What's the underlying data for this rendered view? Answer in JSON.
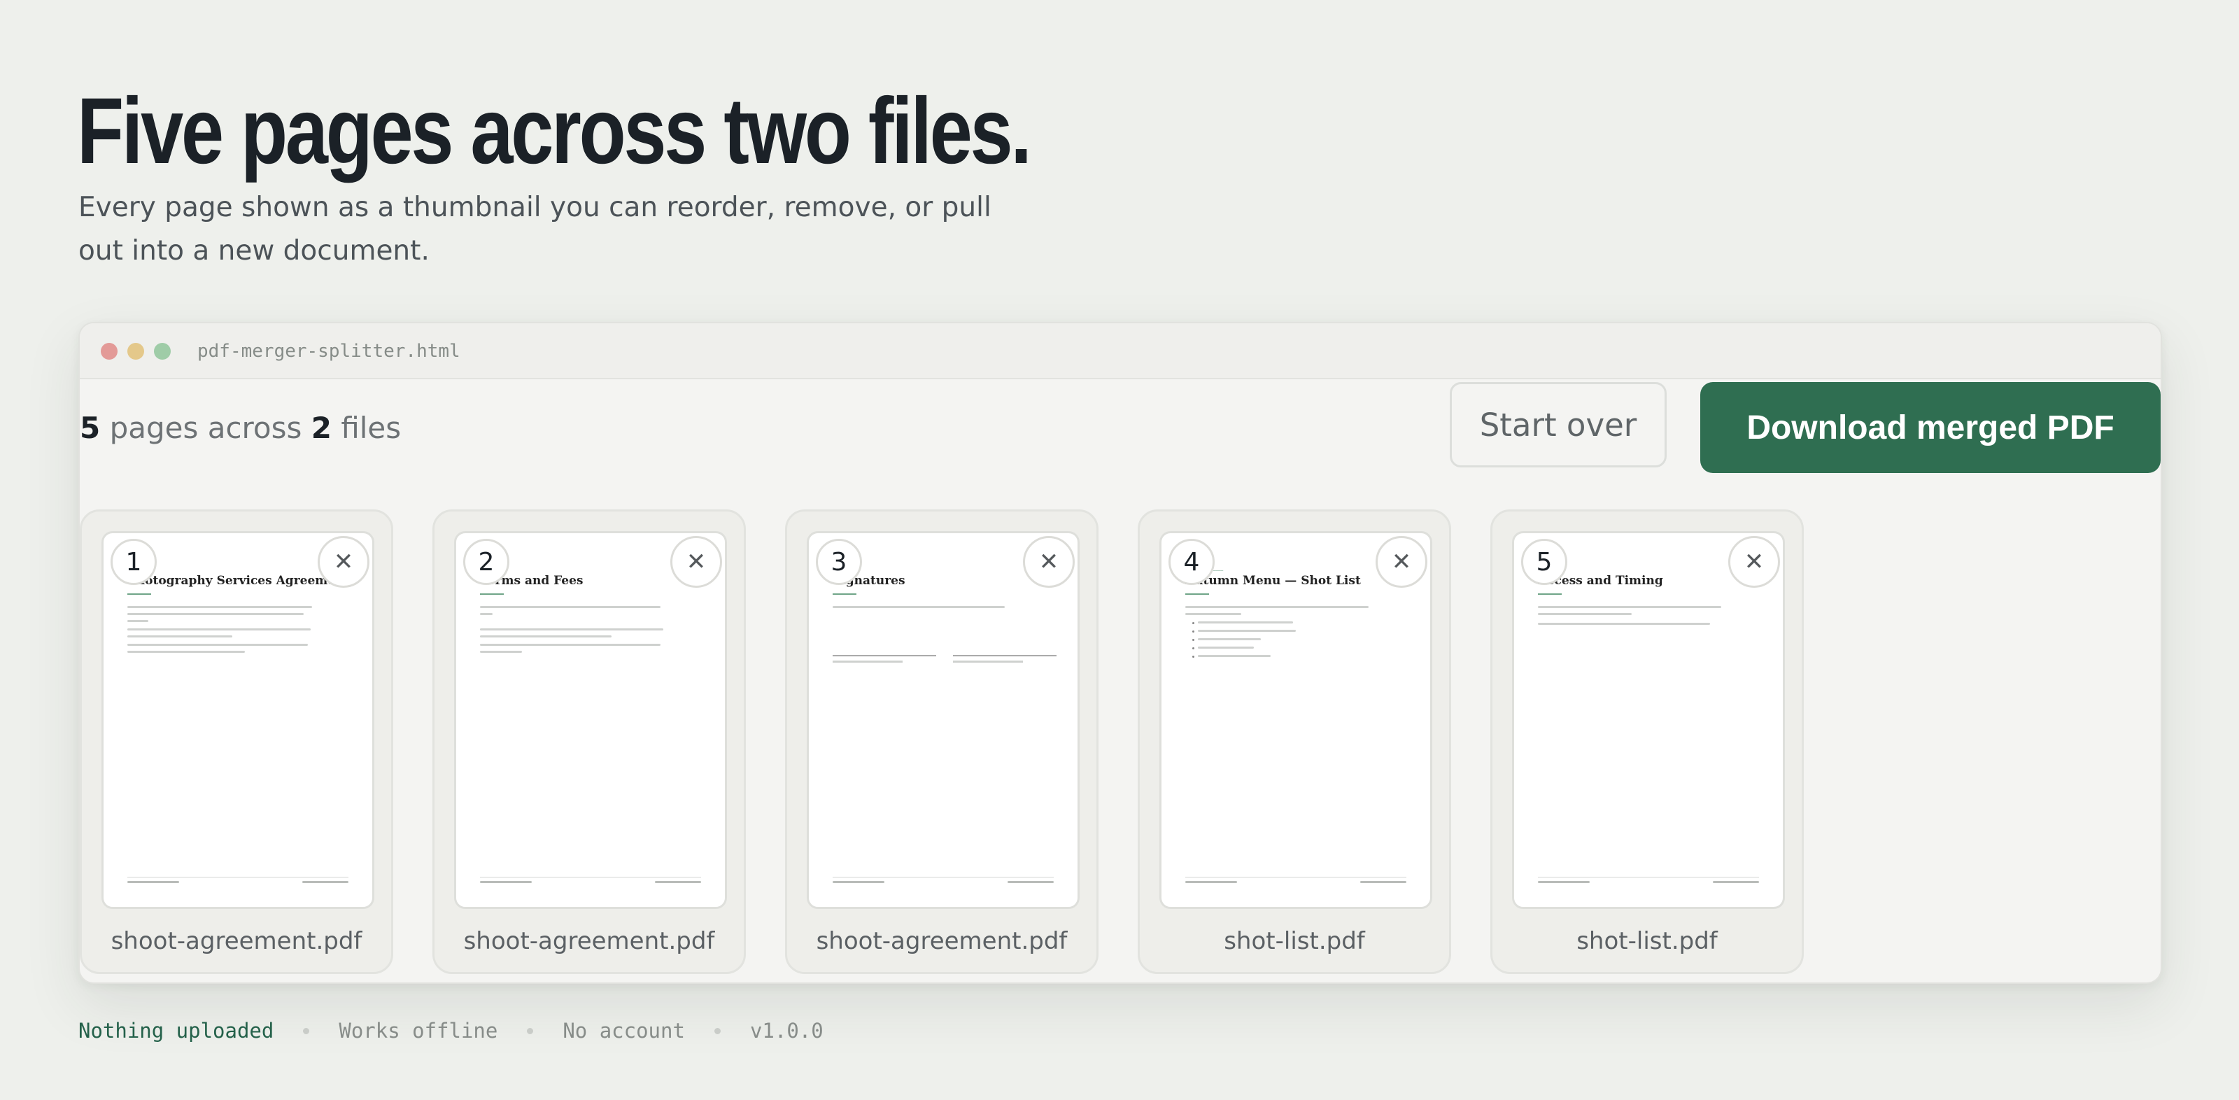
{
  "hero": {
    "title": "Five pages across two files.",
    "subtitle": "Every page shown as a thumbnail you can reorder, remove, or pull out into a new document."
  },
  "window": {
    "filename": "pdf-merger-splitter.html"
  },
  "summary": {
    "page_count": "5",
    "pages_text": "pages across",
    "file_count": "2",
    "files_text": "files"
  },
  "buttons": {
    "start_over": "Start over",
    "download": "Download merged PDF"
  },
  "pages": [
    {
      "number": "1",
      "remove": "✕",
      "title": "Photography Services Agreement",
      "file": "shoot-agreement.pdf"
    },
    {
      "number": "2",
      "remove": "✕",
      "title": "Terms and Fees",
      "file": "shoot-agreement.pdf"
    },
    {
      "number": "3",
      "remove": "✕",
      "title": "Signatures",
      "file": "shoot-agreement.pdf"
    },
    {
      "number": "4",
      "remove": "✕",
      "title": "Autumn Menu — Shot List",
      "file": "shot-list.pdf"
    },
    {
      "number": "5",
      "remove": "✕",
      "title": "Access and Timing",
      "file": "shot-list.pdf"
    }
  ],
  "footer": {
    "items": [
      "Nothing uploaded",
      "Works offline",
      "No account",
      "v1.0.0"
    ]
  },
  "colors": {
    "background": "#eef0ec",
    "accent": "#2f6e51",
    "accent_text": "#24614a"
  }
}
